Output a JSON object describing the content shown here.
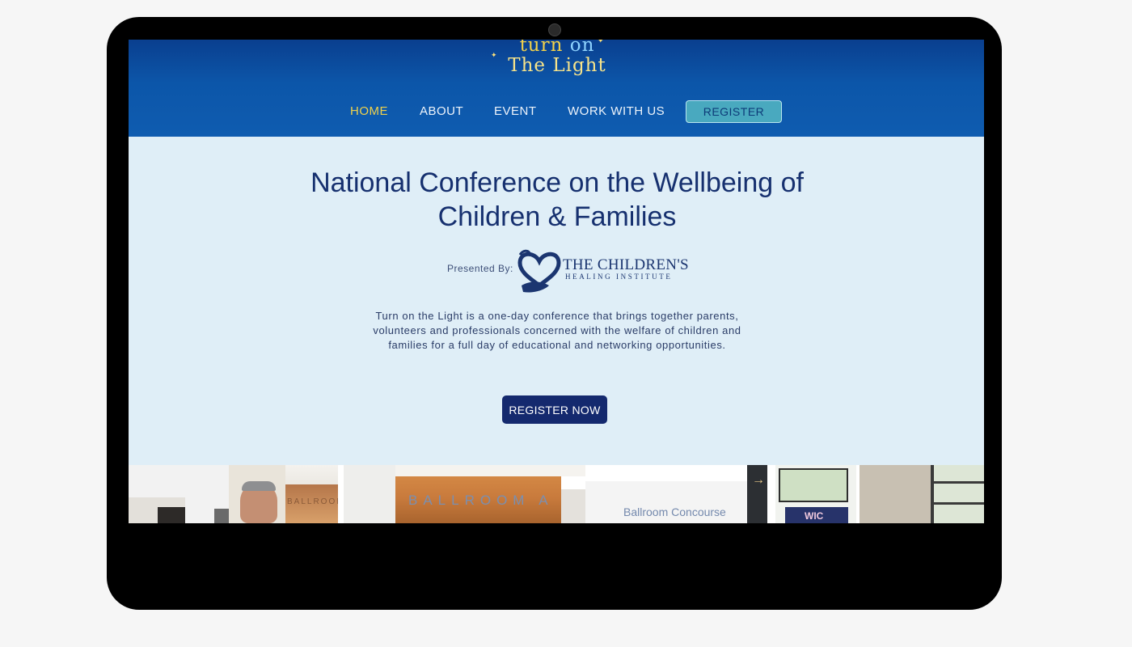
{
  "header": {
    "logo_line1_a": "turn",
    "logo_line1_b": "on",
    "logo_line2": "The Light",
    "nav": [
      "HOME",
      "ABOUT",
      "EVENT",
      "WORK WITH US"
    ],
    "register_label": "REGISTER"
  },
  "hero": {
    "title": "National Conference on the Wellbeing of Children & Families",
    "presented_by": "Presented By:",
    "presenter_name": "The Children's",
    "presenter_sub": "Healing Institute",
    "description": "Turn on the Light is a one-day conference that brings together parents, volunteers and professionals concerned with the welfare of children and families for a full day of educational and networking opportunities.",
    "cta_label": "REGISTER NOW"
  },
  "photos": {
    "sign_ballroom_small": "BALLROOM A",
    "sign_ballroom": "BALLROOM A",
    "sign_concourse": "Ballroom Concourse",
    "sign_wic": "WIC"
  },
  "colors": {
    "header_blue": "#0c56a9",
    "nav_active": "#f0d24b",
    "register_button": "#49a9bf",
    "hero_bg": "#dfeef7",
    "cta_bg": "#14296e",
    "title_text": "#16306f"
  }
}
